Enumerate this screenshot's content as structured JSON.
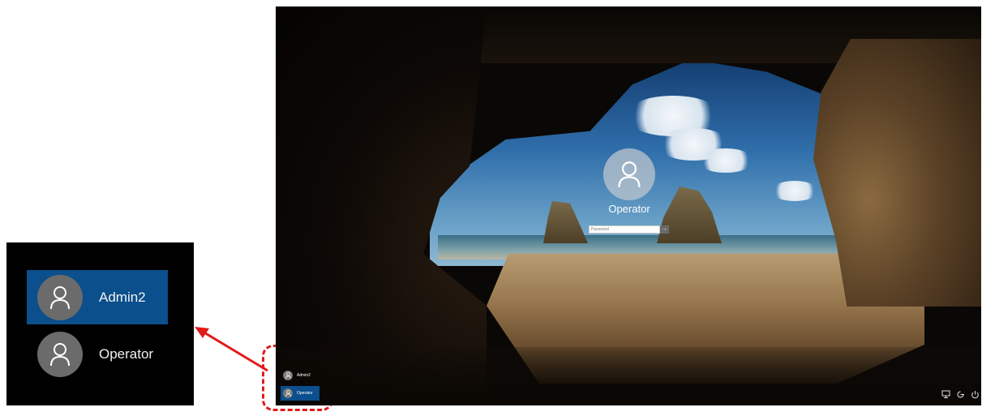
{
  "inset": {
    "users": [
      {
        "name": "Admin2",
        "selected": true
      },
      {
        "name": "Operator",
        "selected": false
      }
    ]
  },
  "lock_screen": {
    "current_user": "Operator",
    "password_placeholder": "Password",
    "submit_glyph": "→",
    "users": [
      {
        "name": "Admin2",
        "selected": false
      },
      {
        "name": "Operator",
        "selected": true
      }
    ],
    "system_icons": [
      "network-icon",
      "ease-of-access-icon",
      "power-icon"
    ]
  },
  "colors": {
    "selection": "#0b4f8c",
    "callout": "#e21b1b"
  }
}
